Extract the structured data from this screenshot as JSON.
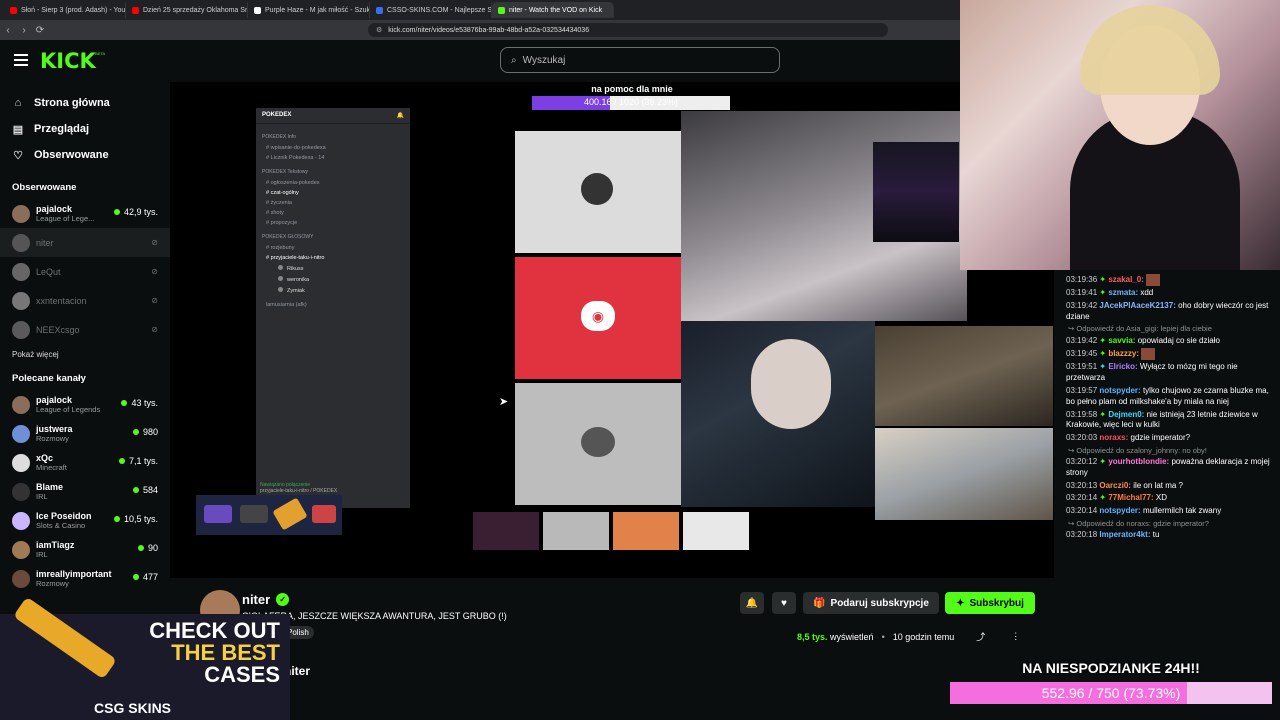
{
  "browser": {
    "tabs": [
      {
        "label": "Słoń - Sierp 3 (prod. Adash) - YouTube",
        "color": "#ff0000"
      },
      {
        "label": "Dzień 25 sprzedaży Oklahoma Smash",
        "color": "#ff0000"
      },
      {
        "label": "Purple Haze - M jak miłość - Szukaj",
        "color": "#ffffff"
      },
      {
        "label": "CSSO-SKINS.COM - Najlepsze Skrzy",
        "color": "#3a6df0"
      },
      {
        "label": "niter - Watch the VOD on Kick",
        "color": "#53fc18"
      }
    ],
    "url": "kick.com/niter/videos/e53876ba-99ab-48bd-a52a-032534434036"
  },
  "header": {
    "logo": "KICK",
    "beta": "BETA",
    "search_placeholder": "Wyszukaj"
  },
  "sidebar": {
    "nav": [
      {
        "label": "Strona główna",
        "icon": "home-icon"
      },
      {
        "label": "Przeglądaj",
        "icon": "browse-icon"
      },
      {
        "label": "Obserwowane",
        "icon": "heart-icon"
      }
    ],
    "following_title": "Obserwowane",
    "following": [
      {
        "name": "pajalock",
        "category": "League of Lege...",
        "viewers": "42,9 tys.",
        "live": true,
        "color": "#8a6d5a"
      },
      {
        "name": "niter",
        "category": "",
        "viewers": "",
        "live": false,
        "color": "#555"
      },
      {
        "name": "LeQut",
        "category": "",
        "viewers": "",
        "live": false,
        "color": "#666"
      },
      {
        "name": "xxntentacion",
        "category": "",
        "viewers": "",
        "live": false,
        "color": "#777"
      },
      {
        "name": "NEEXcsgo",
        "category": "",
        "viewers": "",
        "live": false,
        "color": "#5a5a5a"
      }
    ],
    "show_more": "Pokaż więcej",
    "recommended_title": "Polecane kanały",
    "recommended": [
      {
        "name": "pajalock",
        "category": "League of Legends",
        "viewers": "43 tys.",
        "color": "#8a6d5a"
      },
      {
        "name": "justwera",
        "category": "Rozmowy",
        "viewers": "980",
        "color": "#6f8fd6"
      },
      {
        "name": "xQc",
        "category": "Minecraft",
        "viewers": "7,1 tys.",
        "color": "#dddddd"
      },
      {
        "name": "Blame",
        "category": "IRL",
        "viewers": "584",
        "color": "#333"
      },
      {
        "name": "Ice Poseidon",
        "category": "Slots & Casino",
        "viewers": "10,5 tys.",
        "color": "#c9b6ff"
      },
      {
        "name": "iamTiagz",
        "category": "IRL",
        "viewers": "90",
        "color": "#a07a55"
      },
      {
        "name": "imreallyimportant",
        "category": "Rozmowy",
        "viewers": "477",
        "color": "#6a4a3a"
      }
    ]
  },
  "stream": {
    "goal_text": "na pomoc dla mnie",
    "goal_progress": "400.16 / 1020 (39.23%)",
    "goal_fraction": 0.3923,
    "discord_server": "POKEDEX",
    "discord_sections": [
      {
        "title": "POKEDEX Info",
        "channels": [
          "wpisanie-do-pokedexa",
          "Licznik Pokedexa - 14"
        ]
      },
      {
        "title": "POKEDEX Tekstowy",
        "channels": [
          "ogłoszenia-pokedex",
          "czat-ogólny",
          "życzenia",
          "shoty",
          "propozycje"
        ]
      },
      {
        "title": "POKEDEX GŁOSOWY",
        "channels": [
          "rozjebuny",
          "przyjaciele-taku-i-nitro"
        ]
      }
    ],
    "discord_voice_users": [
      "Rikuss",
      "weronika",
      "Zymiak"
    ],
    "discord_afk": "lamusiarnia (afk)",
    "discord_status": "Nawiązano połączenie",
    "discord_status_sub": "przyjaciele-taku-i-nitro / POKEDEX",
    "sub_goal_label": "NA NIESPODZIANKE 24H!!",
    "sub_goal_progress": "552.96 / 750 (73.73%)",
    "sub_goal_fraction": 0.7373
  },
  "channel": {
    "name": "niter",
    "title": "CIOLAFERA, JESZCZE WIĘKSZA AWANTURA, JEST GRUBO (!)",
    "language": "Polish",
    "views": "8,5 tys.",
    "views_label": "wyświetleń",
    "time_ago": "10 godzin temu",
    "gift_label": "Podaruj subskrypcje",
    "subscribe_label": "Subskrybuj",
    "about_label": "niter"
  },
  "chat": [
    {
      "type": "msg",
      "time": "03:19:36",
      "user": "szakal_0:",
      "text": "",
      "color": "#ff5f5f",
      "badge": "#53fc18"
    },
    {
      "type": "msg",
      "time": "03:19:41",
      "user": "szmata:",
      "text": "xdd",
      "color": "#6fb3ff",
      "badge": "#53fc18"
    },
    {
      "type": "msg",
      "time": "03:19:42",
      "user": "JAcekPlAaceK2137:",
      "text": "oho dobry wieczór co jest dziane",
      "color": "#8ab4ff",
      "badge": ""
    },
    {
      "type": "reply",
      "text": "Odpowiedź do Asia_gigi: lepiej dla ciebie"
    },
    {
      "type": "msg",
      "time": "03:19:42",
      "user": "savvia:",
      "text": "opowiadaj co sie działo",
      "color": "#53fc18",
      "badge": "#53fc18"
    },
    {
      "type": "msg",
      "time": "03:19:45",
      "user": "blazzzy:",
      "text": "",
      "color": "#ffa040",
      "badge": "#53fc18"
    },
    {
      "type": "msg",
      "time": "03:19:51",
      "user": "Elricko:",
      "text": "Wyłącz to mózg mi tego nie przetwarza",
      "color": "#b07cff",
      "badge": "#3ad9ff"
    },
    {
      "type": "msg",
      "time": "03:19:57",
      "user": "notspyder:",
      "text": "tylko chujowo ze czarna bluzke ma, bo pełno plam od milkshake'a by miala na niej",
      "color": "#5fb4ff",
      "badge": ""
    },
    {
      "type": "msg",
      "time": "03:19:58",
      "user": "Dejmen0:",
      "text": "nie istnieją 23 letnie dziewice w Krakowie, więc leci w kulki",
      "color": "#3ad9ff",
      "badge": "#53fc18"
    },
    {
      "type": "msg",
      "time": "03:20:03",
      "user": "noraxs:",
      "text": "gdzie imperator?",
      "color": "#ff4d6d",
      "badge": ""
    },
    {
      "type": "reply",
      "text": "Odpowiedź do szalony_johnny: no oby!"
    },
    {
      "type": "msg",
      "time": "03:20:12",
      "user": "yourhotblondie:",
      "text": "poważna deklaracja z mojej strony",
      "color": "#ff7ad9",
      "badge": "#53fc18"
    },
    {
      "type": "msg",
      "time": "03:20:13",
      "user": "Oarczi0:",
      "text": "ile on lat ma ?",
      "color": "#ff8a5b",
      "badge": ""
    },
    {
      "type": "msg",
      "time": "03:20:14",
      "user": "77Michal77:",
      "text": "XD",
      "color": "#ff7b3a",
      "badge": "#53fc18"
    },
    {
      "type": "msg",
      "time": "03:20:14",
      "user": "notspyder:",
      "text": "mullermilch tak zwany",
      "color": "#5fb4ff",
      "badge": ""
    },
    {
      "type": "reply",
      "text": "Odpowiedź do noraxs: gdzie imperator?"
    },
    {
      "type": "msg",
      "time": "03:20:18",
      "user": "Imperator4kt:",
      "text": "tu",
      "color": "#6fb3ff",
      "badge": ""
    }
  ],
  "ad": {
    "line1": "CHECK OUT",
    "line2": "THE BEST",
    "line3": "CASES",
    "brand": "CSG SKINS"
  }
}
